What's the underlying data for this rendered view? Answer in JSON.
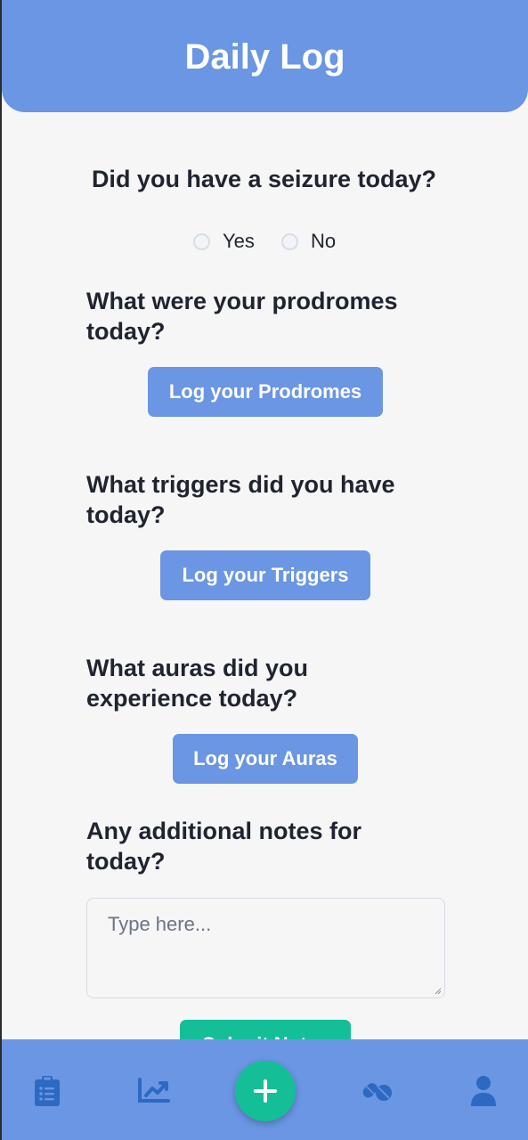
{
  "header": {
    "title": "Daily Log"
  },
  "seizure": {
    "question": "Did you have a seizure today?",
    "options": [
      "Yes",
      "No"
    ],
    "selected": ""
  },
  "prodromes": {
    "question": "What were your prodromes today?",
    "button_label": "Log your Prodromes"
  },
  "triggers": {
    "question": "What triggers did you have today?",
    "button_label": "Log your Triggers"
  },
  "auras": {
    "question": "What auras did you experience today?",
    "button_label": "Log your Auras"
  },
  "notes": {
    "question": "Any additional notes for today?",
    "placeholder": "Type here...",
    "value": "",
    "submit_label": "Submit Notes"
  },
  "bottom_nav": {
    "items": [
      "clipboard-list-icon",
      "chart-line-icon",
      "plus-icon",
      "pills-icon",
      "user-icon"
    ]
  },
  "colors": {
    "primary": "#6a96e3",
    "accent": "#14bf98",
    "nav_icon": "#2d69c2",
    "text": "#1f2430",
    "background": "#f6f6f6"
  }
}
